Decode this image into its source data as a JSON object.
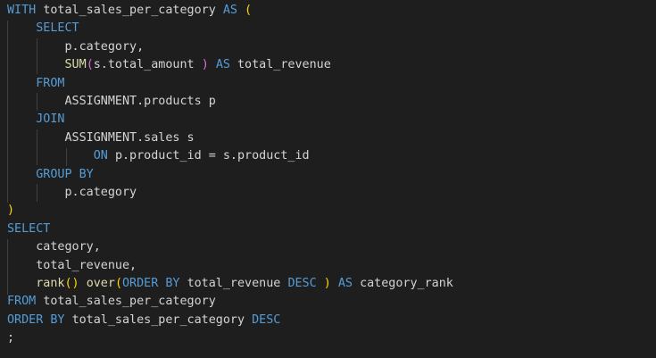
{
  "code": {
    "with_kw": "WITH",
    "cte_name": "total_sales_per_category",
    "as_kw": "AS",
    "open_paren": "(",
    "select_kw": "SELECT",
    "line3_text": "p.category,",
    "sum_fn": "SUM",
    "sum_open": "(",
    "sum_arg": "s.total_amount ",
    "sum_close": ")",
    "as_kw2": "AS",
    "revenue_alias": "total_revenue",
    "from_kw": "FROM",
    "products_table": "ASSIGNMENT.products p",
    "join_kw": "JOIN",
    "sales_table": "ASSIGNMENT.sales s",
    "on_kw": "ON",
    "join_condition": "p.product_id = s.product_id",
    "group_by_kw": "GROUP BY",
    "group_col": "p.category",
    "close_paren": ")",
    "select_kw2": "SELECT",
    "col_category": "category,",
    "col_total_revenue": "total_revenue,",
    "rank_fn": "rank",
    "rank_parens": "()",
    "over_kw": "over",
    "over_open": "(",
    "order_by_kw": "ORDER BY",
    "order_col": "total_revenue",
    "desc_kw": "DESC",
    "over_close": ")",
    "as_kw3": "AS",
    "rank_alias": "category_rank",
    "from_kw2": "FROM",
    "from_table2": "total_sales_per_category",
    "order_by_kw2": "ORDER BY",
    "order_col2": "total_sales_per_category",
    "desc_kw2": "DESC",
    "semicolon": ";"
  },
  "colors": {
    "background": "#1e1e1e",
    "keyword": "#569cd6",
    "function": "#dcdcaa",
    "bracket_level1": "#da70d6",
    "bracket_level2": "#179fff",
    "bracket_level3": "#ffd700",
    "text": "#d4d4d4"
  }
}
